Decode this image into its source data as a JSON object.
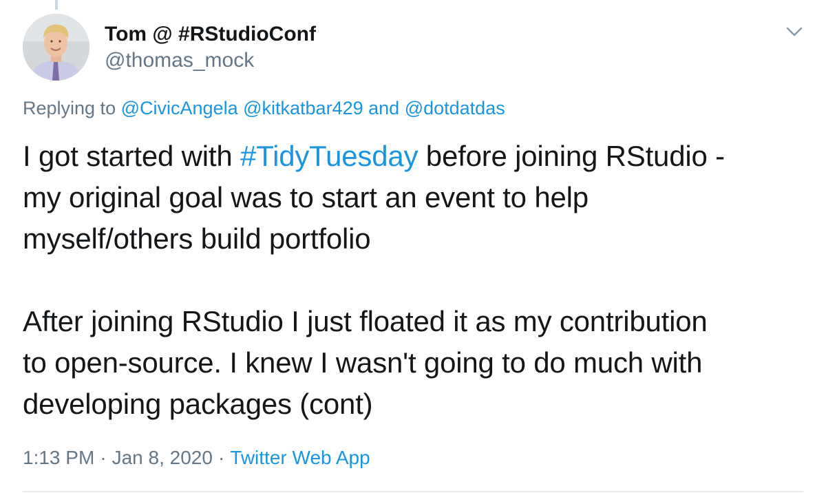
{
  "tweet": {
    "author": {
      "display_name": "Tom @ #RStudioConf",
      "handle": "@thomas_mock"
    },
    "replying_to": {
      "prefix": "Replying to",
      "mention_1": "@CivicAngela",
      "mention_2": "@kitkatbar429",
      "conjunction": "and",
      "mention_3": "@dotdatdas"
    },
    "text": {
      "p1_line1_pre": "I got started with ",
      "p1_hashtag": "#TidyTuesday",
      "p1_line1_post": " before joining RStudio -",
      "p1_line2": "my original goal was to start an event to help",
      "p1_line3": "myself/others build portfolio",
      "p2_line1": "After joining RStudio I just floated it as my contribution",
      "p2_line2": "to open-source. I knew I wasn't going to do much with",
      "p2_line3": "developing packages (cont)"
    },
    "meta": {
      "time": "1:13 PM",
      "separator": "·",
      "date": "Jan 8, 2020",
      "source": "Twitter Web App"
    },
    "icons": {
      "menu": "chevron-down-icon",
      "avatar": "profile-photo"
    },
    "colors": {
      "link": "#1b95e0",
      "secondary_text": "#657786",
      "primary_text": "#14171a"
    }
  }
}
